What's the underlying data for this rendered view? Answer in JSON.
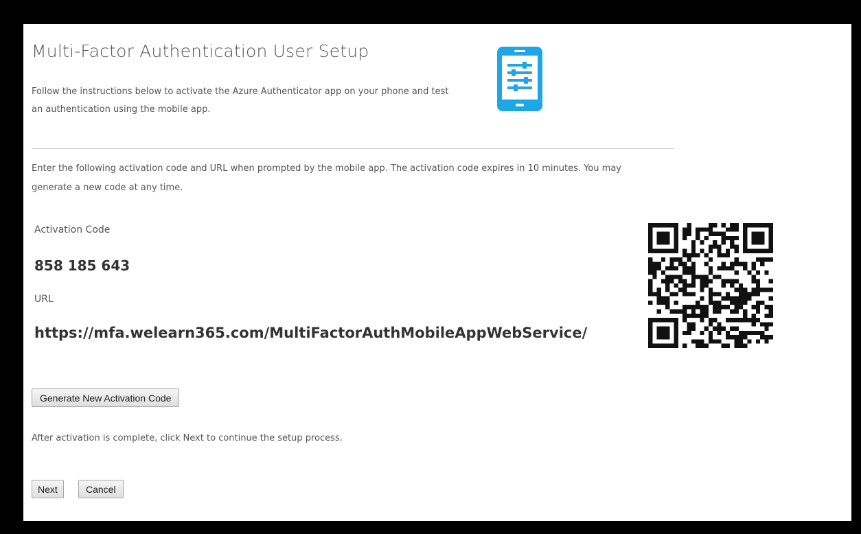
{
  "header": {
    "title": "Multi-Factor Authentication User Setup",
    "intro": "Follow the instructions below to activate the Azure Authenticator app on your phone and test an authentication using the mobile app."
  },
  "instructions": "Enter the following activation code and URL when prompted by the mobile app. The activation code expires in 10 minutes. You may generate a new code at any time.",
  "activation": {
    "code_label": "Activation Code",
    "code_value": "858 185 643",
    "url_label": "URL",
    "url_value": "https://mfa.welearn365.com/MultiFactorAuthMobileAppWebService/"
  },
  "buttons": {
    "generate_label": "Generate New Activation Code",
    "next_label": "Next",
    "cancel_label": "Cancel"
  },
  "after_activation_text": "After activation is complete, click Next to continue the setup process.",
  "icons": {
    "phone_icon": "mobile-phone-settings-icon",
    "qr_code": "qr-code"
  },
  "colors": {
    "accent": "#1fa6e6",
    "background_frame": "#000000",
    "panel": "#ffffff",
    "text": "#555555"
  }
}
